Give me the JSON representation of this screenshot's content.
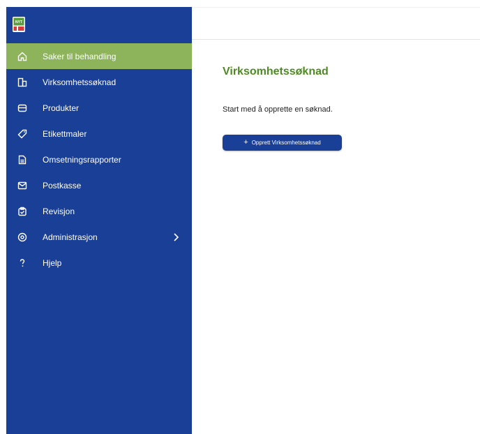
{
  "sidebar": {
    "logo_text": "NYT",
    "items": [
      {
        "label": "Saker til behandling",
        "icon": "home-icon",
        "active": true
      },
      {
        "label": "Virksomhetssøknad",
        "icon": "building-icon",
        "active": false
      },
      {
        "label": "Produkter",
        "icon": "box-icon",
        "active": false
      },
      {
        "label": "Etikettmaler",
        "icon": "tag-icon",
        "active": false
      },
      {
        "label": "Omsetningsrapporter",
        "icon": "document-icon",
        "active": false
      },
      {
        "label": "Postkasse",
        "icon": "mail-icon",
        "active": false
      },
      {
        "label": "Revisjon",
        "icon": "clipboard-check-icon",
        "active": false
      },
      {
        "label": "Administrasjon",
        "icon": "settings-icon",
        "active": false,
        "has_submenu": true
      },
      {
        "label": "Hjelp",
        "icon": "question-icon",
        "active": false
      }
    ]
  },
  "main": {
    "title": "Virksomhetssøknad",
    "subtitle": "Start med å opprette en søknad.",
    "create_button_label": "Opprett Virksomhetssøknad"
  },
  "colors": {
    "sidebar_bg": "#1a3f96",
    "active_item_bg": "#8db35b",
    "title_color": "#4e8a22",
    "button_bg": "#1a3f96"
  }
}
